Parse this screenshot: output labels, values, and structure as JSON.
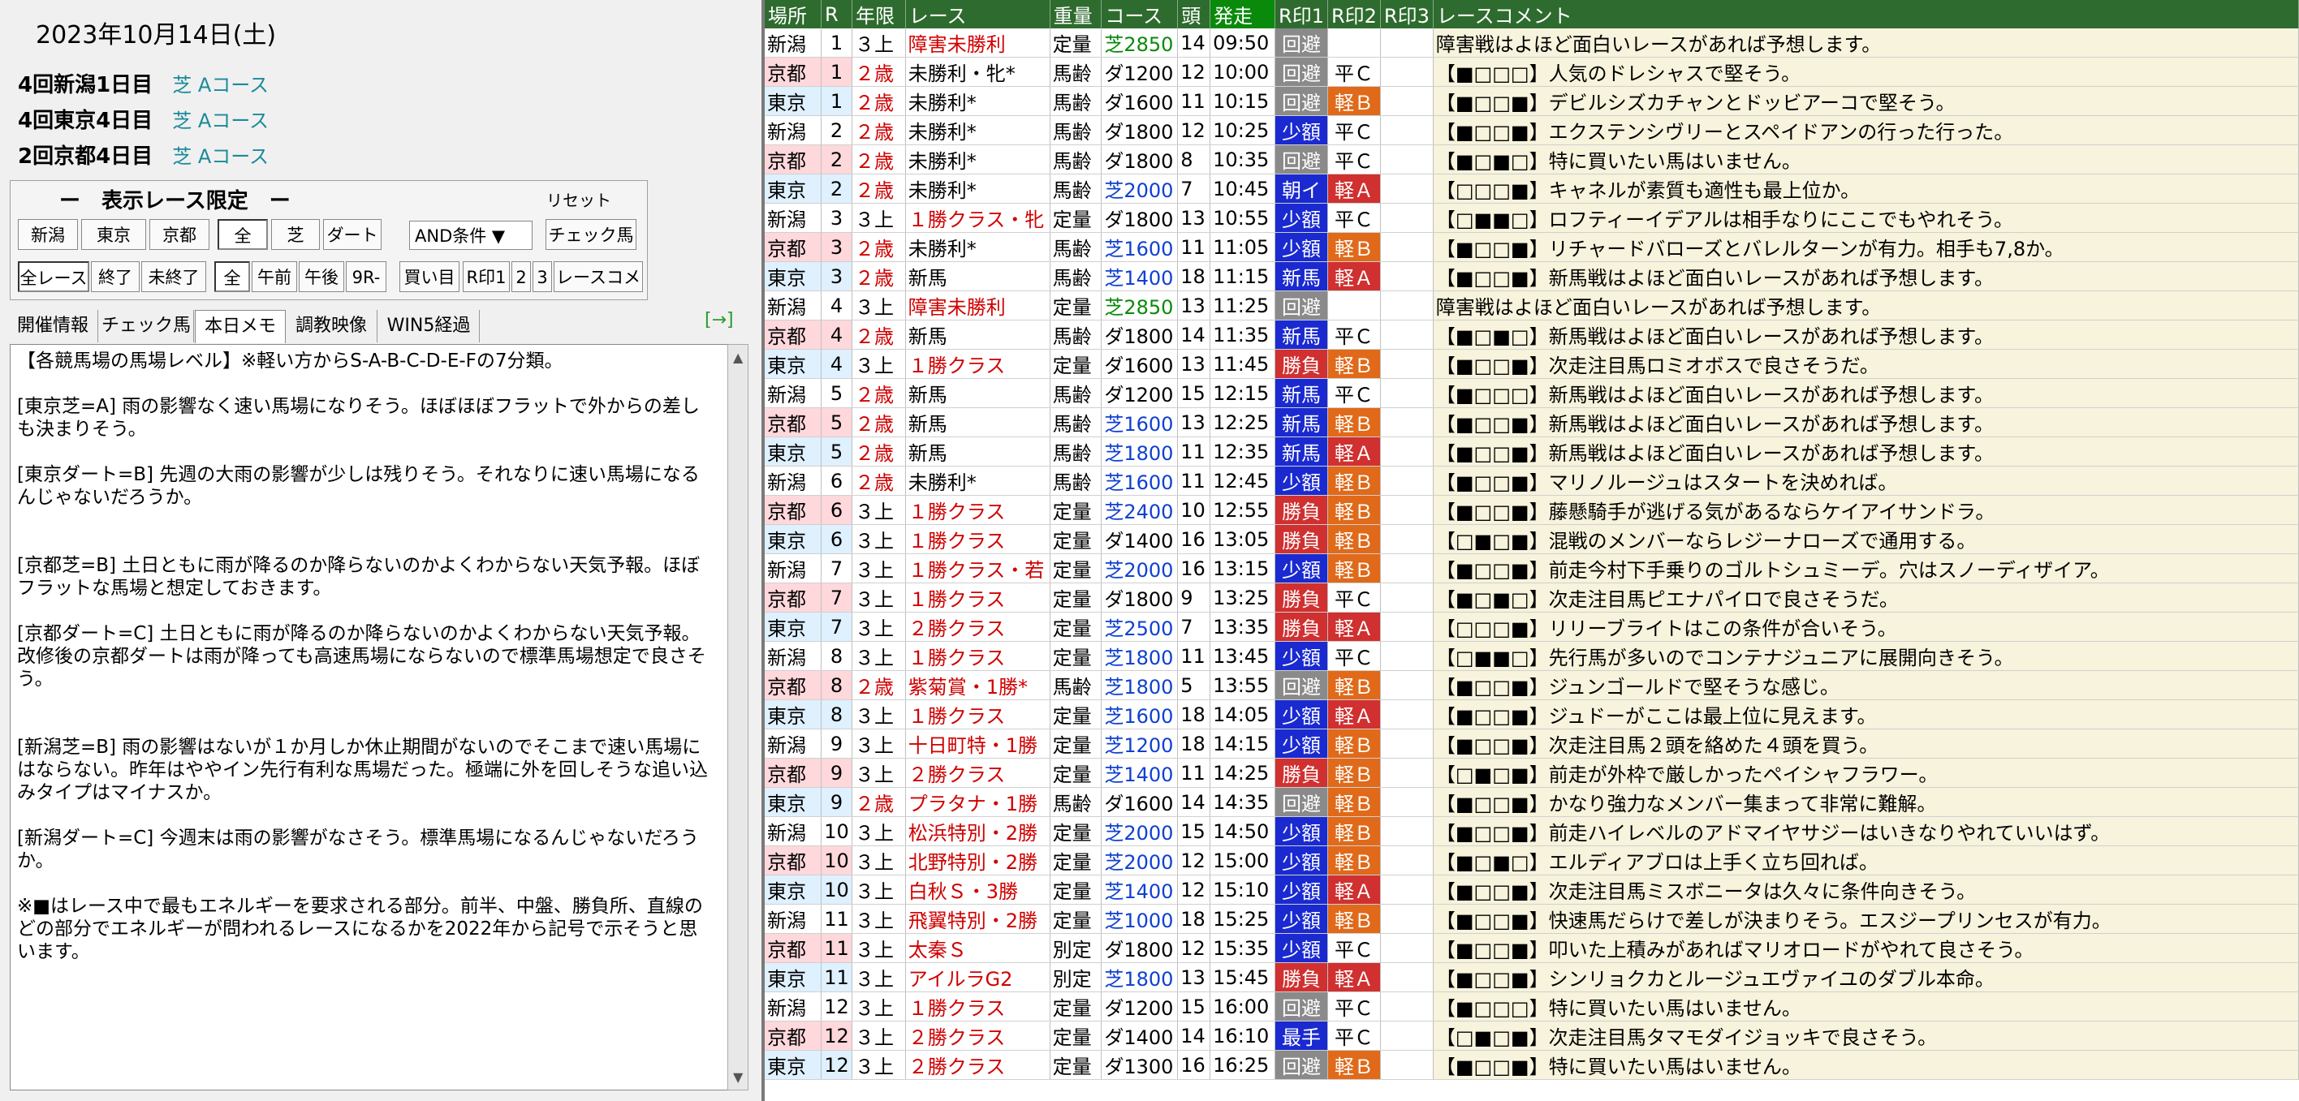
{
  "date": "2023年10月14日(土)",
  "meetings": [
    {
      "name": "4回新潟1日目",
      "course": "芝 Aコース"
    },
    {
      "name": "4回東京4日目",
      "course": "芝 Aコース"
    },
    {
      "name": "2回京都4日目",
      "course": "芝 Aコース"
    }
  ],
  "filter": {
    "title": "ー　表示レース限定　ー",
    "reset": "リセット",
    "row1": [
      "新潟",
      "東京",
      "京都",
      "全",
      "芝",
      "ダート"
    ],
    "condition": "AND条件 ▼",
    "check_horse": "チェック馬",
    "row2": [
      "全レース",
      "終了",
      "未終了",
      "全",
      "午前",
      "午後",
      "9R-",
      "買い目",
      "R印1",
      "2",
      "3",
      "レースコメ"
    ]
  },
  "tabs": [
    "開催情報",
    "チェック馬",
    "本日メモ",
    "調教映像",
    "WIN5経過"
  ],
  "tab_arrow": "[→]",
  "memo": "【各競馬場の馬場レベル】※軽い方からS-A-B-C-D-E-Fの7分類。\n\n[東京芝=A] 雨の影響なく速い馬場になりそう。ほぼほぼフラットで外からの差しも決まりそう。\n\n[東京ダート=B] 先週の大雨の影響が少しは残りそう。それなりに速い馬場になるんじゃないだろうか。\n\n\n[京都芝=B] 土日ともに雨が降るのか降らないのかよくわからない天気予報。ほぼフラットな馬場と想定しておきます。\n\n[京都ダート=C] 土日ともに雨が降るのか降らないのかよくわからない天気予報。改修後の京都ダートは雨が降っても高速馬場にならないので標準馬場想定で良さそう。\n\n\n[新潟芝=B] 雨の影響はないが１か月しか休止期間がないのでそこまで速い馬場にはならない。昨年はややイン先行有利な馬場だった。極端に外を回しそうな追い込みタイプはマイナスか。\n\n[新潟ダート=C] 今週末は雨の影響がなさそう。標準馬場になるんじゃないだろうか。\n\n※■はレース中で最もエネルギーを要求される部分。前半、中盤、勝負所、直線のどの部分でエネルギーが問われるレースになるかを2022年から記号で示そうと思います。",
  "headers": [
    "場所",
    "R",
    "年限",
    "レース",
    "重量",
    "コース",
    "頭",
    "発走",
    "R印1",
    "R印2",
    "R印3",
    "レースコメント"
  ],
  "rows": [
    [
      "新潟",
      "1",
      "３上",
      "障害未勝利",
      "定量",
      "芝2850",
      "14",
      "09:50",
      "回避",
      "",
      "",
      "障害戦はよほど面白いレースがあれば予想します。"
    ],
    [
      "京都",
      "1",
      "２歳",
      "未勝利・牝*",
      "馬齢",
      "ダ1200",
      "12",
      "10:00",
      "回避",
      "平Ｃ",
      "",
      "【■□□□】人気のドレシャスで堅そう。"
    ],
    [
      "東京",
      "1",
      "２歳",
      "未勝利*",
      "馬齢",
      "ダ1600",
      "11",
      "10:15",
      "回避",
      "軽Ｂ",
      "",
      "【■□□■】デビルシズカチャンとドッビアーコで堅そう。"
    ],
    [
      "新潟",
      "2",
      "２歳",
      "未勝利*",
      "馬齢",
      "ダ1800",
      "12",
      "10:25",
      "少額",
      "平Ｃ",
      "",
      "【■□□■】エクステンシヴリーとスペイドアンの行った行った。"
    ],
    [
      "京都",
      "2",
      "２歳",
      "未勝利*",
      "馬齢",
      "ダ1800",
      "8",
      "10:35",
      "回避",
      "平Ｃ",
      "",
      "【■□■□】特に買いたい馬はいません。"
    ],
    [
      "東京",
      "2",
      "２歳",
      "未勝利*",
      "馬齢",
      "芝2000",
      "7",
      "10:45",
      "朝イ",
      "軽Ａ",
      "",
      "【□□□■】キャネルが素質も適性も最上位か。"
    ],
    [
      "新潟",
      "3",
      "３上",
      "１勝クラス・牝",
      "定量",
      "ダ1800",
      "13",
      "10:55",
      "少額",
      "平Ｃ",
      "",
      "【□■■□】ロフティーイデアルは相手なりにここでもやれそう。"
    ],
    [
      "京都",
      "3",
      "２歳",
      "未勝利*",
      "馬齢",
      "芝1600",
      "11",
      "11:05",
      "少額",
      "軽Ｂ",
      "",
      "【■□□■】リチャードバローズとバレルターンが有力。相手も7,8か。"
    ],
    [
      "東京",
      "3",
      "２歳",
      "新馬",
      "馬齢",
      "芝1400",
      "18",
      "11:15",
      "新馬",
      "軽Ａ",
      "",
      "【■□□■】新馬戦はよほど面白いレースがあれば予想します。"
    ],
    [
      "新潟",
      "4",
      "３上",
      "障害未勝利",
      "定量",
      "芝2850",
      "13",
      "11:25",
      "回避",
      "",
      "",
      "障害戦はよほど面白いレースがあれば予想します。"
    ],
    [
      "京都",
      "4",
      "２歳",
      "新馬",
      "馬齢",
      "ダ1800",
      "14",
      "11:35",
      "新馬",
      "平Ｃ",
      "",
      "【■□■□】新馬戦はよほど面白いレースがあれば予想します。"
    ],
    [
      "東京",
      "4",
      "３上",
      "１勝クラス",
      "定量",
      "ダ1600",
      "13",
      "11:45",
      "勝負",
      "軽Ｂ",
      "",
      "【■□□■】次走注目馬ロミオボスで良さそうだ。"
    ],
    [
      "新潟",
      "5",
      "２歳",
      "新馬",
      "馬齢",
      "ダ1200",
      "15",
      "12:15",
      "新馬",
      "平Ｃ",
      "",
      "【■□□□】新馬戦はよほど面白いレースがあれば予想します。"
    ],
    [
      "京都",
      "5",
      "２歳",
      "新馬",
      "馬齢",
      "芝1600",
      "13",
      "12:25",
      "新馬",
      "軽Ｂ",
      "",
      "【■□□■】新馬戦はよほど面白いレースがあれば予想します。"
    ],
    [
      "東京",
      "5",
      "２歳",
      "新馬",
      "馬齢",
      "芝1800",
      "11",
      "12:35",
      "新馬",
      "軽Ａ",
      "",
      "【■□□■】新馬戦はよほど面白いレースがあれば予想します。"
    ],
    [
      "新潟",
      "6",
      "２歳",
      "未勝利*",
      "馬齢",
      "芝1600",
      "11",
      "12:45",
      "少額",
      "軽Ｂ",
      "",
      "【■□□■】マリノルージュはスタートを決めれば。"
    ],
    [
      "京都",
      "6",
      "３上",
      "１勝クラス",
      "定量",
      "芝2400",
      "10",
      "12:55",
      "勝負",
      "軽Ｂ",
      "",
      "【■□□■】藤懸騎手が逃げる気があるならケイアイサンドラ。"
    ],
    [
      "東京",
      "6",
      "３上",
      "１勝クラス",
      "定量",
      "ダ1400",
      "16",
      "13:05",
      "勝負",
      "軽Ｂ",
      "",
      "【□■□■】混戦のメンバーならレジーナローズで通用する。"
    ],
    [
      "新潟",
      "7",
      "３上",
      "１勝クラス・若",
      "定量",
      "芝2000",
      "16",
      "13:15",
      "少額",
      "軽Ｂ",
      "",
      "【■□□■】前走今村下手乗りのゴルトシュミーデ。穴はスノーディザイア。"
    ],
    [
      "京都",
      "7",
      "３上",
      "１勝クラス",
      "定量",
      "ダ1800",
      "9",
      "13:25",
      "勝負",
      "平Ｃ",
      "",
      "【■□■□】次走注目馬ピエナパイロで良さそうだ。"
    ],
    [
      "東京",
      "7",
      "３上",
      "２勝クラス",
      "定量",
      "芝2500",
      "7",
      "13:35",
      "勝負",
      "軽Ａ",
      "",
      "【□□□■】リリーブライトはこの条件が合いそう。"
    ],
    [
      "新潟",
      "8",
      "３上",
      "１勝クラス",
      "定量",
      "芝1800",
      "11",
      "13:45",
      "少額",
      "平Ｃ",
      "",
      "【□■■□】先行馬が多いのでコンテナジュニアに展開向きそう。"
    ],
    [
      "京都",
      "8",
      "２歳",
      "紫菊賞・1勝*",
      "馬齢",
      "芝1800",
      "5",
      "13:55",
      "回避",
      "軽Ｂ",
      "",
      "【■□□■】ジュンゴールドで堅そうな感じ。"
    ],
    [
      "東京",
      "8",
      "３上",
      "１勝クラス",
      "定量",
      "芝1600",
      "18",
      "14:05",
      "少額",
      "軽Ａ",
      "",
      "【■□□■】ジュドーがここは最上位に見えます。"
    ],
    [
      "新潟",
      "9",
      "３上",
      "十日町特・1勝",
      "定量",
      "芝1200",
      "18",
      "14:15",
      "少額",
      "軽Ｂ",
      "",
      "【■□□■】次走注目馬２頭を絡めた４頭を買う。"
    ],
    [
      "京都",
      "9",
      "３上",
      "２勝クラス",
      "定量",
      "芝1400",
      "11",
      "14:25",
      "勝負",
      "軽Ｂ",
      "",
      "【□■□■】前走が外枠で厳しかったペイシャフラワー。"
    ],
    [
      "東京",
      "9",
      "２歳",
      "プラタナ・1勝",
      "馬齢",
      "ダ1600",
      "14",
      "14:35",
      "回避",
      "軽Ｂ",
      "",
      "【■□□■】かなり強力なメンバー集まって非常に難解。"
    ],
    [
      "新潟",
      "10",
      "３上",
      "松浜特別・2勝",
      "定量",
      "芝2000",
      "15",
      "14:50",
      "少額",
      "軽Ｂ",
      "",
      "【■□□■】前走ハイレベルのアドマイヤサジーはいきなりやれていいはず。"
    ],
    [
      "京都",
      "10",
      "３上",
      "北野特別・2勝",
      "定量",
      "芝2000",
      "12",
      "15:00",
      "少額",
      "軽Ｂ",
      "",
      "【■□■□】エルディアブロは上手く立ち回れば。"
    ],
    [
      "東京",
      "10",
      "３上",
      "白秋Ｓ・3勝",
      "定量",
      "芝1400",
      "12",
      "15:10",
      "少額",
      "軽Ａ",
      "",
      "【■□□■】次走注目馬ミスボニータは久々に条件向きそう。"
    ],
    [
      "新潟",
      "11",
      "３上",
      "飛翼特別・2勝",
      "定量",
      "芝1000",
      "18",
      "15:25",
      "少額",
      "軽Ｂ",
      "",
      "【■□□■】快速馬だらけで差しが決まりそう。エスジープリンセスが有力。"
    ],
    [
      "京都",
      "11",
      "３上",
      "太秦Ｓ",
      "別定",
      "ダ1800",
      "12",
      "15:35",
      "少額",
      "平Ｃ",
      "",
      "【■□□■】叩いた上積みがあればマリオロードがやれて良さそう。"
    ],
    [
      "東京",
      "11",
      "３上",
      "アイルラG2",
      "別定",
      "芝1800",
      "13",
      "15:45",
      "勝負",
      "軽Ａ",
      "",
      "【■□□■】シンリョクカとルージュエヴァイユのダブル本命。"
    ],
    [
      "新潟",
      "12",
      "３上",
      "１勝クラス",
      "定量",
      "ダ1200",
      "15",
      "16:00",
      "回避",
      "平Ｃ",
      "",
      "【■□□□】特に買いたい馬はいません。"
    ],
    [
      "京都",
      "12",
      "３上",
      "２勝クラス",
      "定量",
      "ダ1400",
      "14",
      "16:10",
      "最手",
      "平Ｃ",
      "",
      "【□■□■】次走注目馬タマモダイジョッキで良さそう。"
    ],
    [
      "東京",
      "12",
      "３上",
      "２勝クラス",
      "定量",
      "ダ1300",
      "16",
      "16:25",
      "回避",
      "軽Ｂ",
      "",
      "【■□□■】特に買いたい馬はいません。"
    ]
  ]
}
